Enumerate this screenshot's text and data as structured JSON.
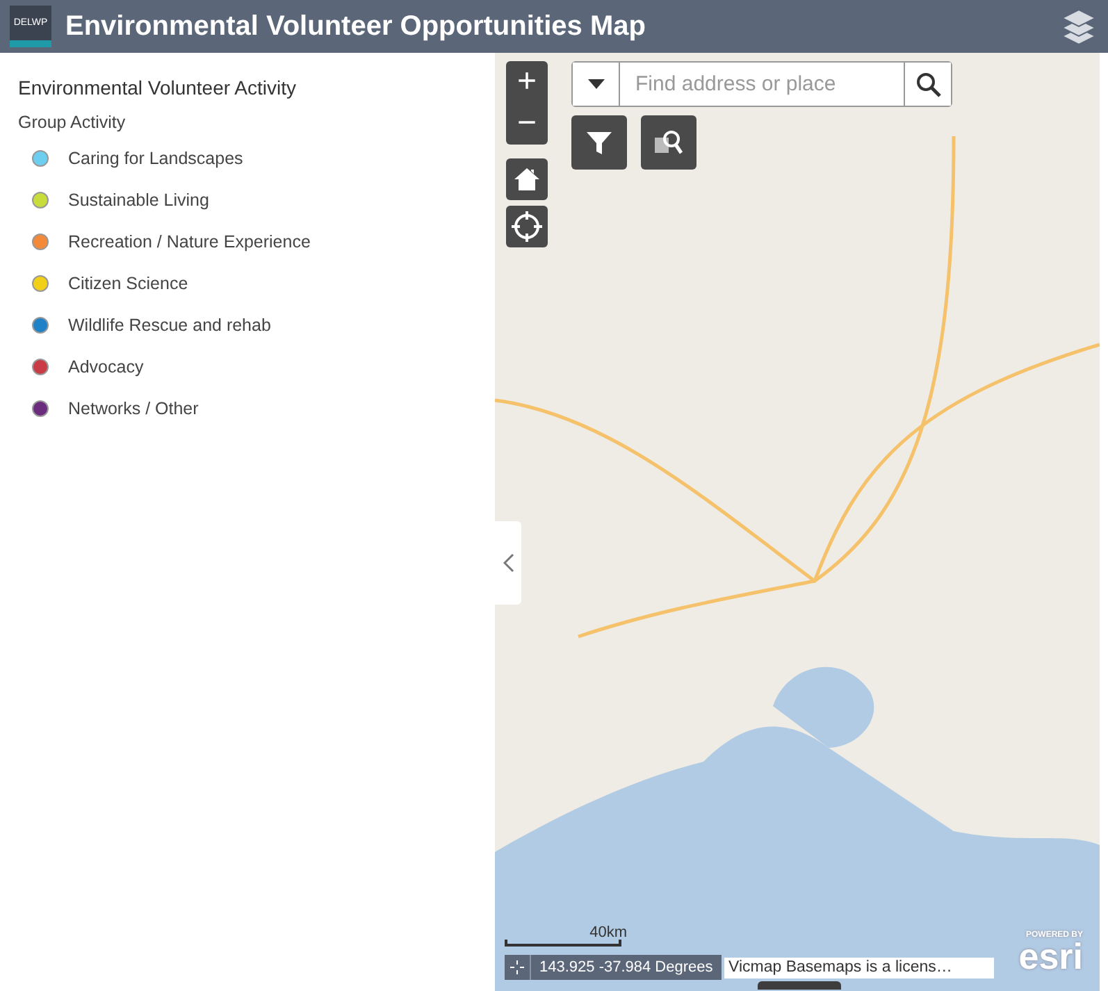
{
  "header": {
    "logo": "DELWP",
    "title": "Environmental Volunteer Opportunities Map"
  },
  "legend": {
    "title": "Environmental Volunteer Activity",
    "group": "Group Activity",
    "items": [
      {
        "label": "Caring for Landscapes",
        "color": "#6ccff0"
      },
      {
        "label": "Sustainable Living",
        "color": "#c8dc3c"
      },
      {
        "label": "Recreation / Nature Experience",
        "color": "#f5893a"
      },
      {
        "label": "Citizen Science",
        "color": "#f2d017"
      },
      {
        "label": "Wildlife Rescue and rehab",
        "color": "#1f82c8"
      },
      {
        "label": "Advocacy",
        "color": "#c93c46"
      },
      {
        "label": "Networks / Other",
        "color": "#6b2c7d"
      }
    ]
  },
  "map": {
    "zoom_in": "+",
    "zoom_out": "−",
    "search": {
      "placeholder": "Find address or place"
    },
    "scale": "40km",
    "coordinates": "143.925 -37.984 Degrees",
    "attribution": "Vicmap Basemaps is a licens…",
    "powered_by": "POWERED BY",
    "esri": "esri"
  }
}
